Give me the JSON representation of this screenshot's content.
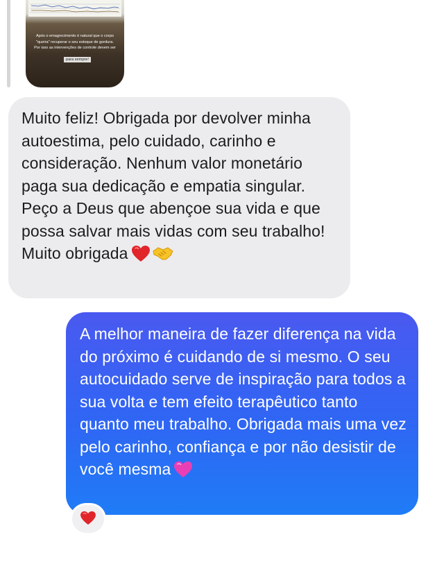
{
  "story_reply": {
    "caption": "Após o emagrecimento é natural que o corpo\n\"queira\" recuperar o seu estoque de gordura.\nPor isso as intervenções de controle devem ser",
    "caption_tail": "para sempre!"
  },
  "messages": [
    {
      "direction": "received",
      "text": "Muito feliz! Obrigada por devolver minha autoestima, pelo cuidado, carinho e consideração. Nenhum valor monetário paga sua dedicação e empatia singular. Peço a Deus que abençoe sua vida e que possa salvar mais vidas com seu trabalho! Muito obrigada",
      "emojis": [
        "red-heart",
        "handshake"
      ]
    },
    {
      "direction": "sent",
      "text": "A melhor maneira de fazer diferença na vida do próximo é cuidando de si mesmo. O seu autocuidado serve de inspiração para todos a sua volta e tem efeito terapêutico tanto quanto meu trabalho. Obrigada mais uma vez pelo carinho, confiança e por não desistir de você mesma",
      "emojis": [
        "pink-heart"
      ]
    }
  ],
  "reaction": {
    "emoji": "red-heart"
  },
  "colors": {
    "received_bubble": "#ececee",
    "sent_bubble_top": "#4a59f0",
    "sent_bubble_bottom": "#1f7cf6",
    "red_heart": "#e0262b",
    "pink_heart": "#ea3fb4"
  }
}
